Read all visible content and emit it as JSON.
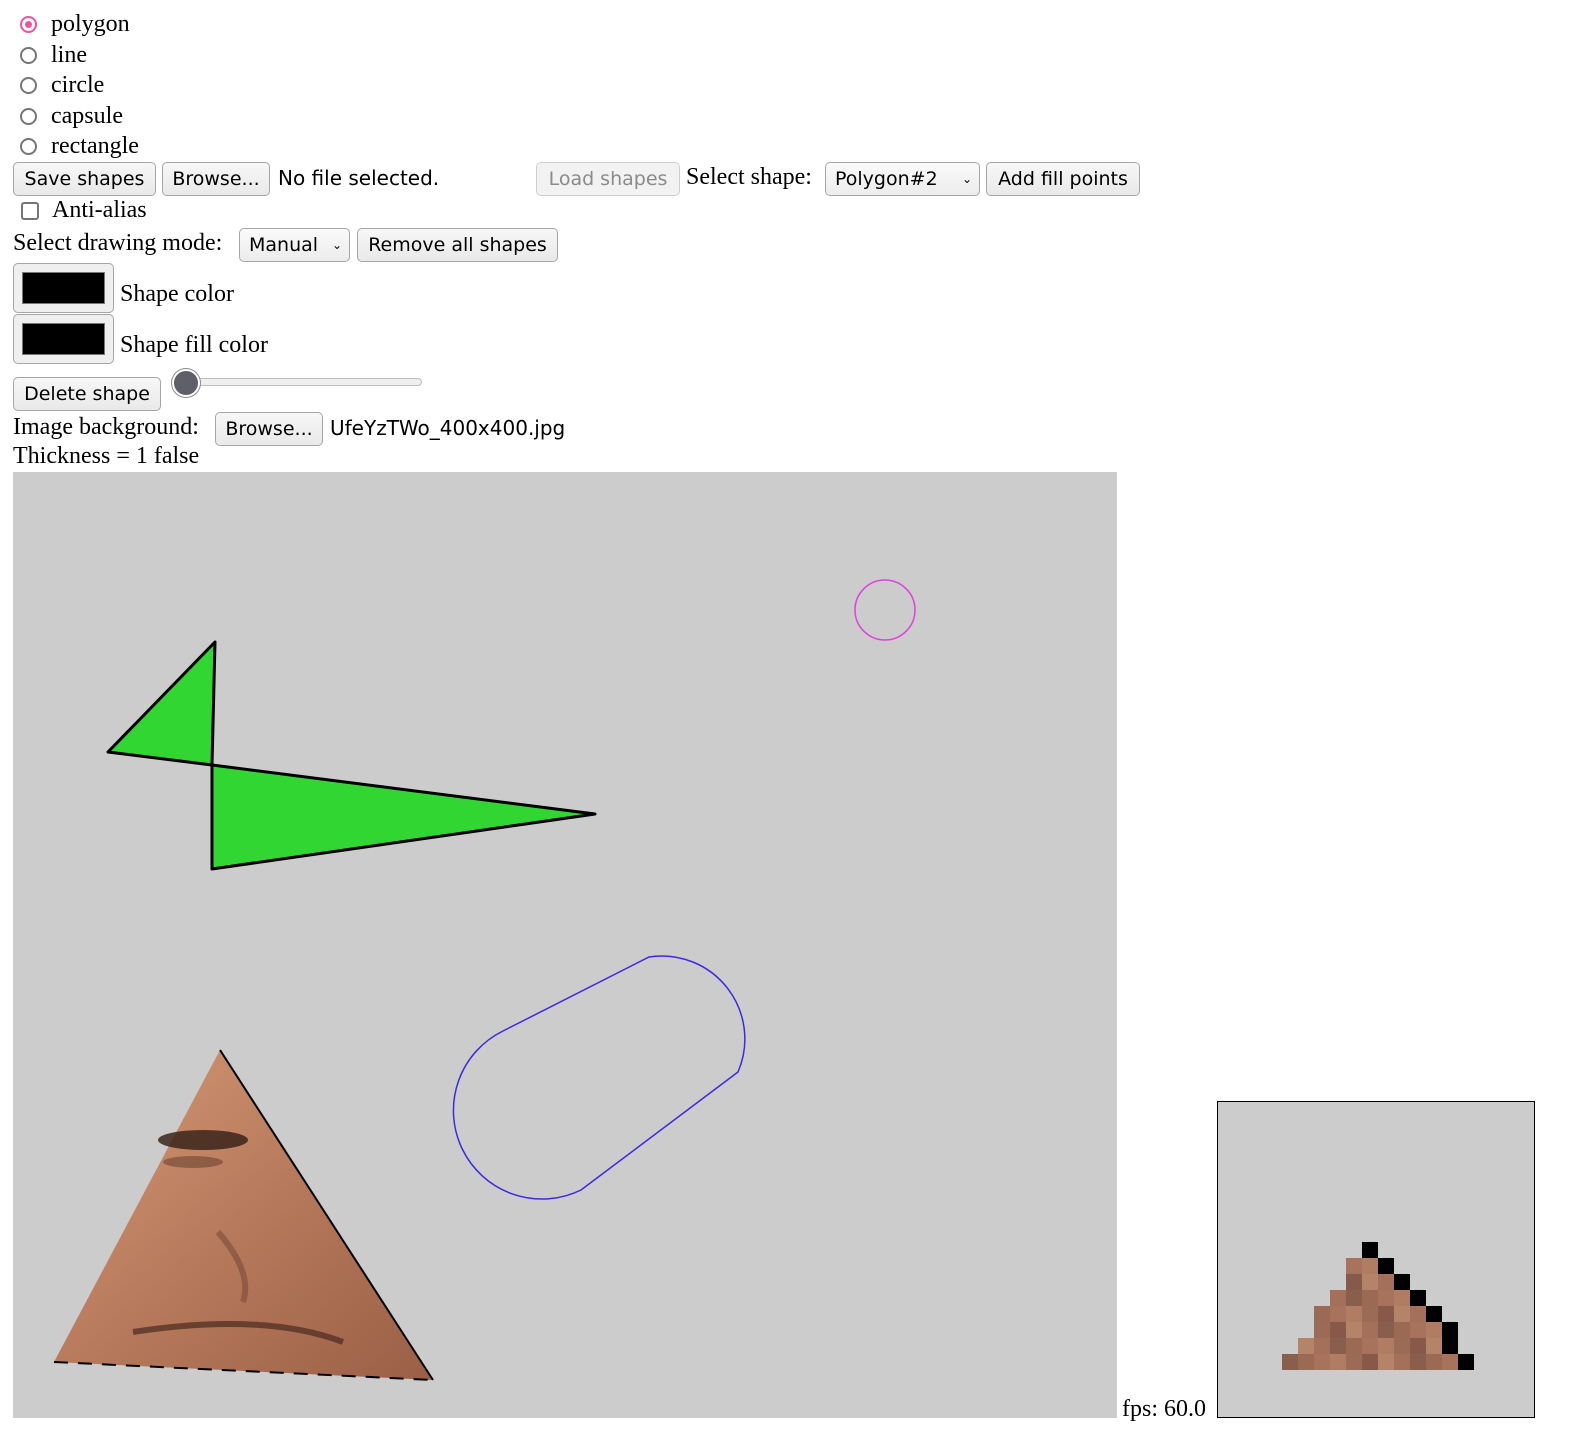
{
  "shape_types": [
    {
      "label": "polygon",
      "checked": true
    },
    {
      "label": "line",
      "checked": false
    },
    {
      "label": "circle",
      "checked": false
    },
    {
      "label": "capsule",
      "checked": false
    },
    {
      "label": "rectangle",
      "checked": false
    }
  ],
  "toolbar": {
    "save_label": "Save shapes",
    "browse_label": "Browse...",
    "file_status": "No file selected.",
    "load_label": "Load shapes",
    "select_shape_label": "Select shape:",
    "selected_shape": "Polygon#2",
    "add_fill_label": "Add fill points"
  },
  "anti_alias": {
    "label": "Anti-alias",
    "checked": false
  },
  "drawing_mode": {
    "label": "Select drawing mode:",
    "value": "Manual",
    "remove_all_label": "Remove all shapes"
  },
  "colors": {
    "shape_color_label": "Shape color",
    "shape_color": "#000000",
    "fill_color_label": "Shape fill color",
    "fill_color": "#000000",
    "polygon_fill": "#32d632",
    "circle_stroke": "#e040e0",
    "capsule_stroke": "#3a2ae0",
    "canvas_bg": "#cccccc"
  },
  "delete_label": "Delete shape",
  "thickness_slider": {
    "value": 1,
    "min": 1,
    "max": 20
  },
  "background": {
    "label": "Image background:",
    "browse_label": "Browse...",
    "file_name": "UfeYzTWo_400x400.jpg"
  },
  "thickness_text": "Thickness = 1 false",
  "fps_text": "fps: 60.0"
}
